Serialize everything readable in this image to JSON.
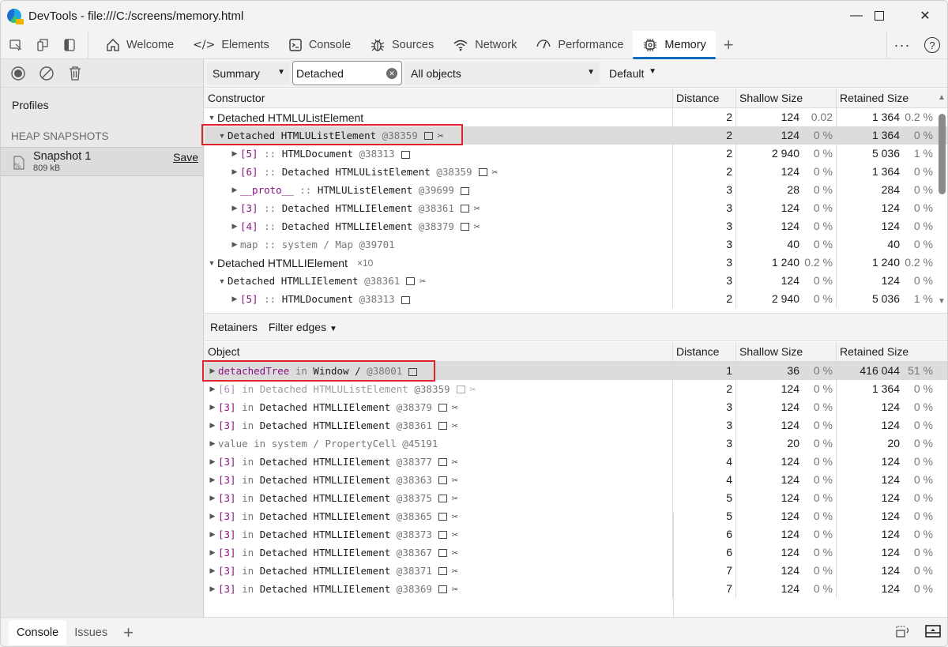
{
  "window": {
    "title": "DevTools - file:///C:/screens/memory.html",
    "controls": [
      "minimize",
      "maximize",
      "close"
    ]
  },
  "tabs": [
    {
      "label": "Welcome",
      "icon": "home-icon",
      "active": false
    },
    {
      "label": "Elements",
      "icon": "code-brackets-icon",
      "active": false
    },
    {
      "label": "Console",
      "icon": "console-icon",
      "active": false
    },
    {
      "label": "Sources",
      "icon": "bug-icon",
      "active": false
    },
    {
      "label": "Network",
      "icon": "wifi-icon",
      "active": false
    },
    {
      "label": "Performance",
      "icon": "gauge-icon",
      "active": false
    },
    {
      "label": "Memory",
      "icon": "chip-icon",
      "active": true
    }
  ],
  "sidebar": {
    "profiles_label": "Profiles",
    "heap_heading": "HEAP SNAPSHOTS",
    "snapshot": {
      "name": "Snapshot 1",
      "size": "809 kB",
      "save_label": "Save"
    }
  },
  "toolbar": {
    "view": "Summary",
    "filter_value": "Detached",
    "filter_placeholder": "Filter",
    "object_filter": "All objects",
    "sort": "Default"
  },
  "summary": {
    "columns": [
      "Constructor",
      "Distance",
      "Shallow Size",
      "Retained Size"
    ],
    "rows": [
      {
        "indent": 0,
        "tri": "down",
        "kind": "group",
        "name": "Detached HTMLUListElement",
        "count": "",
        "distance": "2",
        "shallow": "124",
        "shallow_pct": "0.02 %",
        "retained": "1 364",
        "retained_pct": "0.2 %"
      },
      {
        "indent": 1,
        "tri": "down",
        "kind": "node",
        "name": "Detached HTMLUListElement",
        "id": "@38359",
        "node_icon": true,
        "detached": true,
        "selected": true,
        "distance": "2",
        "shallow": "124",
        "shallow_pct": "0 %",
        "retained": "1 364",
        "retained_pct": "0 %"
      },
      {
        "indent": 2,
        "tri": "right",
        "kind": "edge",
        "prop": "[5]",
        "sep": " :: ",
        "name": "HTMLDocument",
        "id": "@38313",
        "node_icon": true,
        "detached": false,
        "distance": "2",
        "shallow": "2 940",
        "shallow_pct": "0 %",
        "retained": "5 036",
        "retained_pct": "1 %"
      },
      {
        "indent": 2,
        "tri": "right",
        "kind": "edge",
        "prop": "[6]",
        "sep": " :: ",
        "name": "Detached HTMLUListElement",
        "id": "@38359",
        "node_icon": true,
        "detached": true,
        "distance": "2",
        "shallow": "124",
        "shallow_pct": "0 %",
        "retained": "1 364",
        "retained_pct": "0 %"
      },
      {
        "indent": 2,
        "tri": "right",
        "kind": "edge",
        "prop": "__proto__",
        "sep": " :: ",
        "name": "HTMLUListElement",
        "id": "@39699",
        "node_icon": true,
        "detached": false,
        "distance": "3",
        "shallow": "28",
        "shallow_pct": "0 %",
        "retained": "284",
        "retained_pct": "0 %"
      },
      {
        "indent": 2,
        "tri": "right",
        "kind": "edge",
        "prop": "[3]",
        "sep": " :: ",
        "name": "Detached HTMLLIElement",
        "id": "@38361",
        "node_icon": true,
        "detached": true,
        "distance": "3",
        "shallow": "124",
        "shallow_pct": "0 %",
        "retained": "124",
        "retained_pct": "0 %"
      },
      {
        "indent": 2,
        "tri": "right",
        "kind": "edge",
        "prop": "[4]",
        "sep": " :: ",
        "name": "Detached HTMLLIElement",
        "id": "@38379",
        "node_icon": true,
        "detached": true,
        "distance": "3",
        "shallow": "124",
        "shallow_pct": "0 %",
        "retained": "124",
        "retained_pct": "0 %"
      },
      {
        "indent": 2,
        "tri": "right",
        "kind": "system",
        "text": "map :: system / Map @39701",
        "distance": "3",
        "shallow": "40",
        "shallow_pct": "0 %",
        "retained": "40",
        "retained_pct": "0 %"
      },
      {
        "indent": 0,
        "tri": "down",
        "kind": "group",
        "name": "Detached HTMLLIElement",
        "count": "×10",
        "distance": "3",
        "shallow": "1 240",
        "shallow_pct": "0.2 %",
        "retained": "1 240",
        "retained_pct": "0.2 %"
      },
      {
        "indent": 1,
        "tri": "down",
        "kind": "node",
        "name": "Detached HTMLLIElement",
        "id": "@38361",
        "node_icon": true,
        "detached": true,
        "distance": "3",
        "shallow": "124",
        "shallow_pct": "0 %",
        "retained": "124",
        "retained_pct": "0 %"
      },
      {
        "indent": 2,
        "tri": "right",
        "kind": "edge",
        "prop": "[5]",
        "sep": " :: ",
        "name": "HTMLDocument",
        "id": "@38313",
        "node_icon": true,
        "detached": false,
        "distance": "2",
        "shallow": "2 940",
        "shallow_pct": "0 %",
        "retained": "5 036",
        "retained_pct": "1 %"
      }
    ]
  },
  "retainers": {
    "label": "Retainers",
    "filter_edges": "Filter edges",
    "columns": [
      "Object",
      "Distance",
      "Shallow Size",
      "Retained Size"
    ],
    "rows": [
      {
        "tri": "right",
        "prop": "detachedTree",
        "sep": " in ",
        "name": "Window /  ",
        "id": "@38001",
        "node_icon": true,
        "detached": false,
        "selected": true,
        "distance": "1",
        "shallow": "36",
        "shallow_pct": "0 %",
        "retained": "416 044",
        "retained_pct": "51 %"
      },
      {
        "tri": "right",
        "prop": "[6]",
        "sep": " in ",
        "name": "Detached HTMLUListElement",
        "id": "@38359",
        "node_icon": true,
        "detached": true,
        "faded": true,
        "distance": "2",
        "shallow": "124",
        "shallow_pct": "0 %",
        "retained": "1 364",
        "retained_pct": "0 %"
      },
      {
        "tri": "right",
        "prop": "[3]",
        "sep": " in ",
        "name": "Detached HTMLLIElement",
        "id": "@38379",
        "node_icon": true,
        "detached": true,
        "distance": "3",
        "shallow": "124",
        "shallow_pct": "0 %",
        "retained": "124",
        "retained_pct": "0 %"
      },
      {
        "tri": "right",
        "prop": "[3]",
        "sep": " in ",
        "name": "Detached HTMLLIElement",
        "id": "@38361",
        "node_icon": true,
        "detached": true,
        "distance": "3",
        "shallow": "124",
        "shallow_pct": "0 %",
        "retained": "124",
        "retained_pct": "0 %"
      },
      {
        "tri": "right",
        "kind": "system",
        "text": "value in system / PropertyCell @45191",
        "distance": "3",
        "shallow": "20",
        "shallow_pct": "0 %",
        "retained": "20",
        "retained_pct": "0 %"
      },
      {
        "tri": "right",
        "prop": "[3]",
        "sep": " in ",
        "name": "Detached HTMLLIElement",
        "id": "@38377",
        "node_icon": true,
        "detached": true,
        "distance": "4",
        "shallow": "124",
        "shallow_pct": "0 %",
        "retained": "124",
        "retained_pct": "0 %"
      },
      {
        "tri": "right",
        "prop": "[3]",
        "sep": " in ",
        "name": "Detached HTMLLIElement",
        "id": "@38363",
        "node_icon": true,
        "detached": true,
        "distance": "4",
        "shallow": "124",
        "shallow_pct": "0 %",
        "retained": "124",
        "retained_pct": "0 %"
      },
      {
        "tri": "right",
        "prop": "[3]",
        "sep": " in ",
        "name": "Detached HTMLLIElement",
        "id": "@38375",
        "node_icon": true,
        "detached": true,
        "distance": "5",
        "shallow": "124",
        "shallow_pct": "0 %",
        "retained": "124",
        "retained_pct": "0 %"
      },
      {
        "tri": "right",
        "prop": "[3]",
        "sep": " in ",
        "name": "Detached HTMLLIElement",
        "id": "@38365",
        "node_icon": true,
        "detached": true,
        "distance": "5",
        "shallow": "124",
        "shallow_pct": "0 %",
        "retained": "124",
        "retained_pct": "0 %"
      },
      {
        "tri": "right",
        "prop": "[3]",
        "sep": " in ",
        "name": "Detached HTMLLIElement",
        "id": "@38373",
        "node_icon": true,
        "detached": true,
        "distance": "6",
        "shallow": "124",
        "shallow_pct": "0 %",
        "retained": "124",
        "retained_pct": "0 %"
      },
      {
        "tri": "right",
        "prop": "[3]",
        "sep": " in ",
        "name": "Detached HTMLLIElement",
        "id": "@38367",
        "node_icon": true,
        "detached": true,
        "distance": "6",
        "shallow": "124",
        "shallow_pct": "0 %",
        "retained": "124",
        "retained_pct": "0 %"
      },
      {
        "tri": "right",
        "prop": "[3]",
        "sep": " in ",
        "name": "Detached HTMLLIElement",
        "id": "@38371",
        "node_icon": true,
        "detached": true,
        "distance": "7",
        "shallow": "124",
        "shallow_pct": "0 %",
        "retained": "124",
        "retained_pct": "0 %"
      },
      {
        "tri": "right",
        "prop": "[3]",
        "sep": " in ",
        "name": "Detached HTMLLIElement",
        "id": "@38369",
        "node_icon": true,
        "detached": true,
        "distance": "7",
        "shallow": "124",
        "shallow_pct": "0 %",
        "retained": "124",
        "retained_pct": "0 %"
      }
    ]
  },
  "drawer": {
    "tabs": [
      {
        "label": "Console",
        "active": true
      },
      {
        "label": "Issues",
        "active": false
      }
    ]
  },
  "colors": {
    "accent": "#0f6cbd",
    "highlight_border": "#e0242d",
    "property": "#881280",
    "selected_row": "#dcdcdc"
  }
}
